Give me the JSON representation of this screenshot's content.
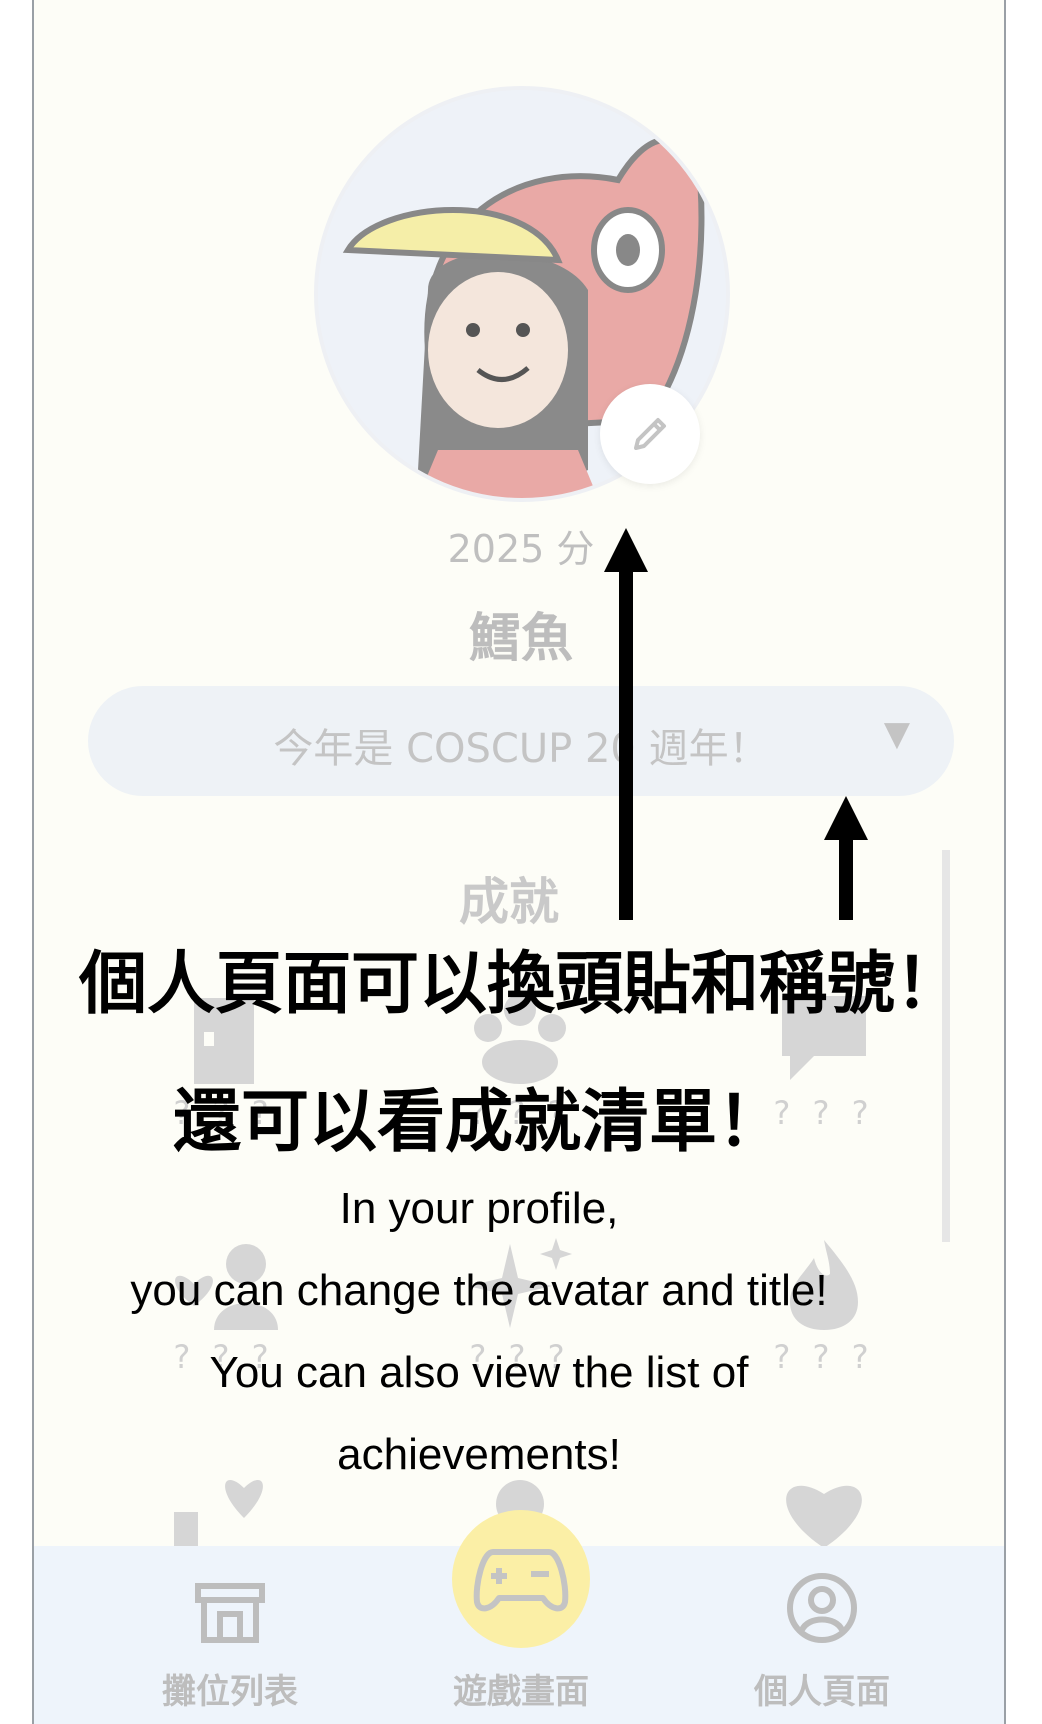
{
  "profile": {
    "score": "2025 分",
    "username": "鱈魚",
    "title_selected": "今年是 COSCUP 20 週年！",
    "caret": "▼"
  },
  "achievements": {
    "heading": "成就",
    "locked_label": "? ? ?"
  },
  "nav": {
    "booths": "攤位列表",
    "game": "遊戲畫面",
    "profile": "個人頁面"
  },
  "overlay": {
    "zh_line1": "個人頁面可以換頭貼和稱號！",
    "zh_line2": "還可以看成就清單！",
    "en_line1": "In your profile,",
    "en_line2": "you can change the avatar and title!",
    "en_line3": "You can also view the list of",
    "en_line4": "achievements!"
  },
  "colors": {
    "accent_yellow": "#fbefa6",
    "nav_bg": "#eef4fb",
    "page_bg": "#fdfdf7"
  }
}
